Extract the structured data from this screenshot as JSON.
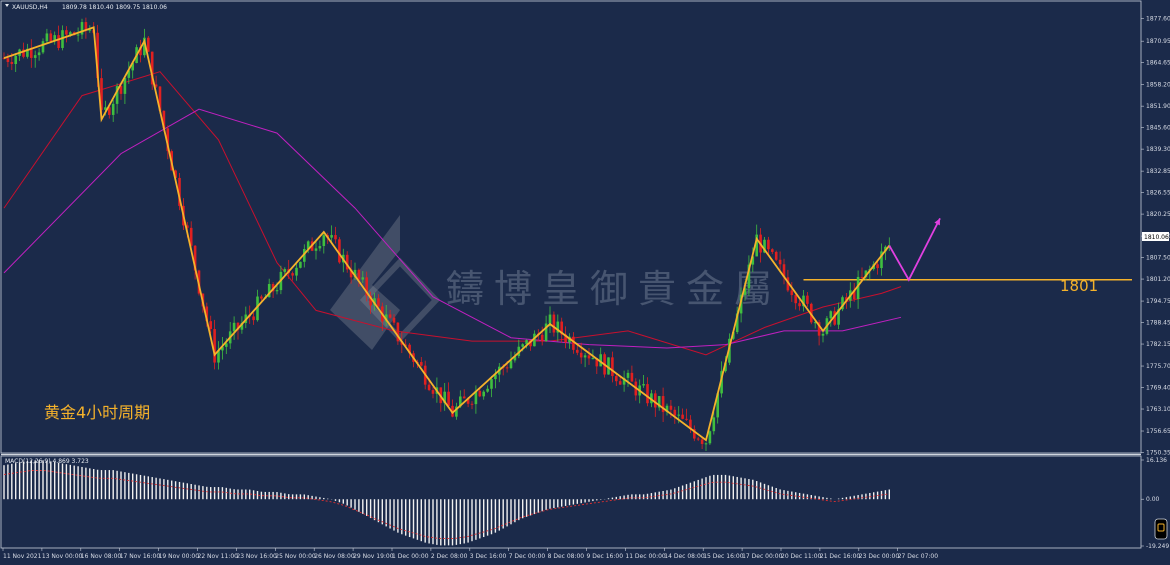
{
  "header": {
    "symbol": "XAUUSD,H4",
    "ohlc": "1809.78 1810.40 1809.75 1810.06"
  },
  "caption": "黄金4小时周期",
  "level_label": "1801",
  "watermark": "鑄博皇御貴金屬",
  "macd_label": "MACD(12,26,9) 4.869 3.723",
  "colors": {
    "background": "#1b2a4a",
    "bull": "#3fbf3f",
    "bear": "#e02020",
    "zigzag": "#f5b22b",
    "projection": "#e040e0",
    "ma_fast": "#c8102e",
    "ma_slow": "#c020c0",
    "macd_bar": "#f0f0f0",
    "macd_signal": "#e03030"
  },
  "chart_data": {
    "type": "candlestick",
    "price_axis": {
      "ylim": [
        1750.35,
        1883.0
      ],
      "ticks": [
        "1877.60",
        "1870.95",
        "1864.65",
        "1858.20",
        "1851.90",
        "1845.60",
        "1839.30",
        "1832.85",
        "1826.55",
        "1820.25",
        "1813.80",
        "1807.50",
        "1801.20",
        "1794.75",
        "1788.45",
        "1782.15",
        "1775.70",
        "1769.40",
        "1763.10",
        "1756.65",
        "1750.35"
      ],
      "current_price": "1810.06"
    },
    "macd_axis": {
      "ylim": [
        -19.249,
        16.136
      ],
      "ticks": [
        "16.136",
        "0.00",
        "-19.249"
      ]
    },
    "x_ticks": [
      "11 Nov 2021",
      "13 Nov 00:00",
      "16 Nov 08:00",
      "17 Nov 16:00",
      "19 Nov 00:00",
      "22 Nov 11:00",
      "23 Nov 16:00",
      "25 Nov 00:00",
      "26 Nov 08:00",
      "29 Nov 19:00",
      "1 Dec 00:00",
      "2 Dec 08:00",
      "3 Dec 16:00",
      "7 Dec 00:00",
      "8 Dec 08:00",
      "9 Dec 16:00",
      "11 Dec 00:00",
      "14 Dec 08:00",
      "15 Dec 16:00",
      "17 Dec 00:00",
      "20 Dec 11:00",
      "21 Dec 16:00",
      "23 Dec 00:00",
      "27 Dec 07:00"
    ],
    "bar_count": 230,
    "zigzag": [
      [
        0,
        1866
      ],
      [
        23,
        1875
      ],
      [
        25,
        1848
      ],
      [
        36,
        1871
      ],
      [
        54,
        1779
      ],
      [
        82,
        1815
      ],
      [
        115,
        1762
      ],
      [
        140,
        1788
      ],
      [
        180,
        1754
      ],
      [
        193,
        1813
      ],
      [
        210,
        1786
      ],
      [
        227,
        1811
      ]
    ],
    "projection": [
      [
        227,
        1811
      ],
      [
        232,
        1801
      ],
      [
        240,
        1819
      ]
    ],
    "horizontal_level": {
      "value": 1801,
      "from_bar": 205
    },
    "ma_fast": [
      [
        0,
        1822
      ],
      [
        20,
        1855
      ],
      [
        40,
        1862
      ],
      [
        55,
        1842
      ],
      [
        70,
        1806
      ],
      [
        80,
        1792
      ],
      [
        100,
        1786
      ],
      [
        120,
        1783
      ],
      [
        140,
        1783
      ],
      [
        160,
        1786
      ],
      [
        180,
        1779
      ],
      [
        195,
        1787
      ],
      [
        210,
        1793
      ],
      [
        225,
        1797
      ],
      [
        230,
        1799
      ]
    ],
    "ma_slow": [
      [
        0,
        1803
      ],
      [
        30,
        1838
      ],
      [
        50,
        1851
      ],
      [
        70,
        1844
      ],
      [
        90,
        1822
      ],
      [
        110,
        1796
      ],
      [
        130,
        1784
      ],
      [
        150,
        1782
      ],
      [
        170,
        1781
      ],
      [
        185,
        1782
      ],
      [
        200,
        1786
      ],
      [
        215,
        1786
      ],
      [
        230,
        1790
      ]
    ],
    "macd_hist": [
      14,
      15,
      16,
      16,
      15,
      14,
      13,
      12,
      12,
      11,
      10,
      9,
      8,
      7,
      6,
      5,
      5,
      4,
      4,
      3,
      3,
      2,
      2,
      1,
      0,
      -2,
      -5,
      -8,
      -11,
      -14,
      -16,
      -18,
      -19,
      -19,
      -18,
      -16,
      -14,
      -11,
      -8,
      -6,
      -4,
      -3,
      -2,
      -1,
      0,
      1,
      2,
      2,
      3,
      4,
      6,
      8,
      10,
      10,
      9,
      8,
      6,
      4,
      3,
      2,
      1,
      0,
      1,
      2,
      3,
      4
    ]
  }
}
